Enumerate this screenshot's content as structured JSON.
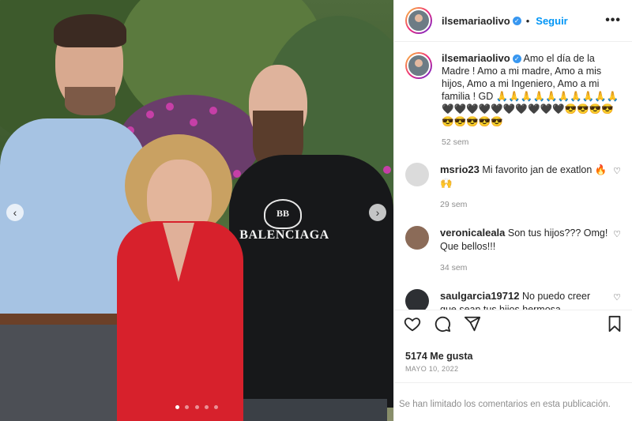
{
  "post": {
    "username": "ilsemariaolivo",
    "follow_label": "Seguir",
    "more_label": "•••",
    "caption_text": "Amo el día de la Madre ! Amo a mi madre, Amo a mis hijos, Amo a mi Ingeniero, Amo a mi familia ! GD 🙏🙏🙏🙏🙏🙏🙏🙏🙏🙏🖤🖤🖤🖤🖤🖤🖤🖤🖤🖤😎😎😎😎😎😎😎😎😎",
    "caption_age": "52 sem"
  },
  "comments": [
    {
      "user": "msrio23",
      "text": "Mi favorito jan de exatlon 🔥🙌",
      "age": "29 sem"
    },
    {
      "user": "veronicaleala",
      "text": "Son tus hijos??? Omg! Que bellos!!!",
      "age": "34 sem"
    },
    {
      "user": "saulgarcia19712",
      "text": "No puedo creer que sean tus hijos hermosa",
      "age": ""
    }
  ],
  "photo": {
    "shirt_text": "BALENCIAGA",
    "shirt_logo": "BB",
    "carousel_dots": 5,
    "active_dot": 1
  },
  "footer": {
    "likes": "5174 Me gusta",
    "date": "MAYO 10, 2022",
    "comments_limited": "Se han limitado los comentarios en esta publicación."
  },
  "icons": {
    "like": "heart-icon",
    "comment": "comment-icon",
    "share": "share-icon",
    "save": "bookmark-icon",
    "prev": "chevron-left-icon",
    "next": "chevron-right-icon"
  },
  "colors": {
    "link": "#0095f6",
    "verified": "#3897f0",
    "muted": "#8e8e8e"
  }
}
